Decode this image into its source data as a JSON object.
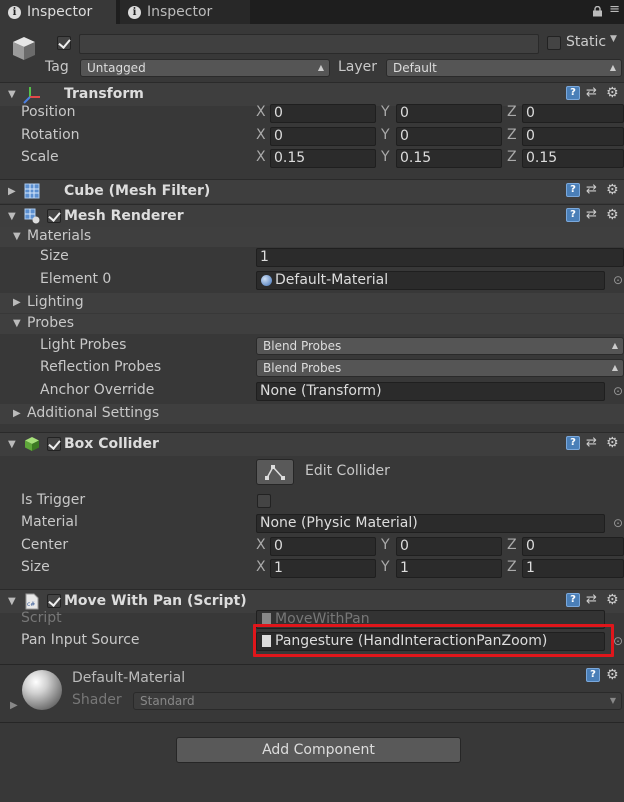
{
  "tabs": [
    {
      "label": "Inspector",
      "active": true
    },
    {
      "label": "Inspector",
      "active": false
    }
  ],
  "window_controls": {
    "lock": "lock-icon",
    "menu": "≡"
  },
  "gameobject": {
    "name": "",
    "active": true,
    "static_label": "Static",
    "tag_label": "Tag",
    "tag_value": "Untagged",
    "layer_label": "Layer",
    "layer_value": "Default"
  },
  "transform": {
    "title": "Transform",
    "rows": [
      {
        "label": "Position",
        "x": "0",
        "y": "0",
        "z": "0"
      },
      {
        "label": "Rotation",
        "x": "0",
        "y": "0",
        "z": "0"
      },
      {
        "label": "Scale",
        "x": "0.15",
        "y": "0.15",
        "z": "0.15"
      }
    ],
    "axis": {
      "x": "X",
      "y": "Y",
      "z": "Z"
    }
  },
  "mesh_filter": {
    "title": "Cube (Mesh Filter)"
  },
  "mesh_renderer": {
    "title": "Mesh Renderer",
    "enabled": true,
    "materials_label": "Materials",
    "size_label": "Size",
    "size_value": "1",
    "element0_label": "Element 0",
    "element0_value": "Default-Material",
    "lighting_label": "Lighting",
    "probes_label": "Probes",
    "light_probes_label": "Light Probes",
    "light_probes_value": "Blend Probes",
    "reflection_probes_label": "Reflection Probes",
    "reflection_probes_value": "Blend Probes",
    "anchor_override_label": "Anchor Override",
    "anchor_override_value": "None (Transform)",
    "additional_label": "Additional Settings"
  },
  "box_collider": {
    "title": "Box Collider",
    "enabled": true,
    "edit_collider_label": "Edit Collider",
    "is_trigger_label": "Is Trigger",
    "is_trigger": false,
    "material_label": "Material",
    "material_value": "None (Physic Material)",
    "center_label": "Center",
    "center": {
      "x": "0",
      "y": "0",
      "z": "0"
    },
    "size_label": "Size",
    "size": {
      "x": "1",
      "y": "1",
      "z": "1"
    }
  },
  "move_with_pan": {
    "title": "Move With Pan (Script)",
    "enabled": true,
    "script_label": "Script",
    "script_value": "MoveWithPan",
    "pan_input_label": "Pan Input Source",
    "pan_input_value": "Pangesture (HandInteractionPanZoom)"
  },
  "material_preview": {
    "name": "Default-Material",
    "shader_label": "Shader",
    "shader_value": "Standard"
  },
  "add_component_label": "Add Component",
  "colors": {
    "highlight": "#e0161b",
    "accent": "#4a7fb8"
  }
}
